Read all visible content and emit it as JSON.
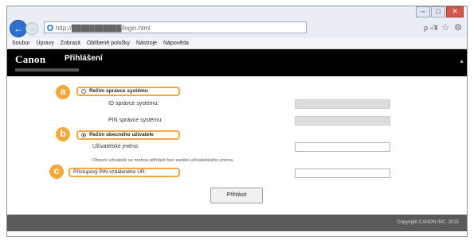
{
  "window": {
    "controls": [
      "–",
      "□",
      "✕"
    ]
  },
  "browser": {
    "url": "http://███████████/login.html",
    "tools": "ρ ‑ ¢",
    "icons": [
      "home-icon",
      "star-icon",
      "gear-icon"
    ],
    "menu": [
      "Soubor",
      "Úpravy",
      "Zobrazit",
      "Oblíbené položky",
      "Nástroje",
      "Nápověda"
    ]
  },
  "header": {
    "brand": "Canon",
    "title": "Přihlášení"
  },
  "options": {
    "admin": {
      "label": "Režim správce systému",
      "callout": "a"
    },
    "general": {
      "label": "Režim obecného uživatele",
      "callout": "b"
    },
    "pin": {
      "label": "Přístupový PIN vzdáleného UR:",
      "callout": "c"
    }
  },
  "fields": {
    "admin_id_label": "ID správce systému:",
    "admin_pin_label": "PIN správce systému:",
    "username_label": "Uživatelské jméno:",
    "note": "Obecní uživatelé se mohou přihlásit bez zadání uživatelského jména."
  },
  "buttons": {
    "login": "Přihlásit"
  },
  "footer": {
    "copyright": "Copyright CANON INC. 2015"
  }
}
